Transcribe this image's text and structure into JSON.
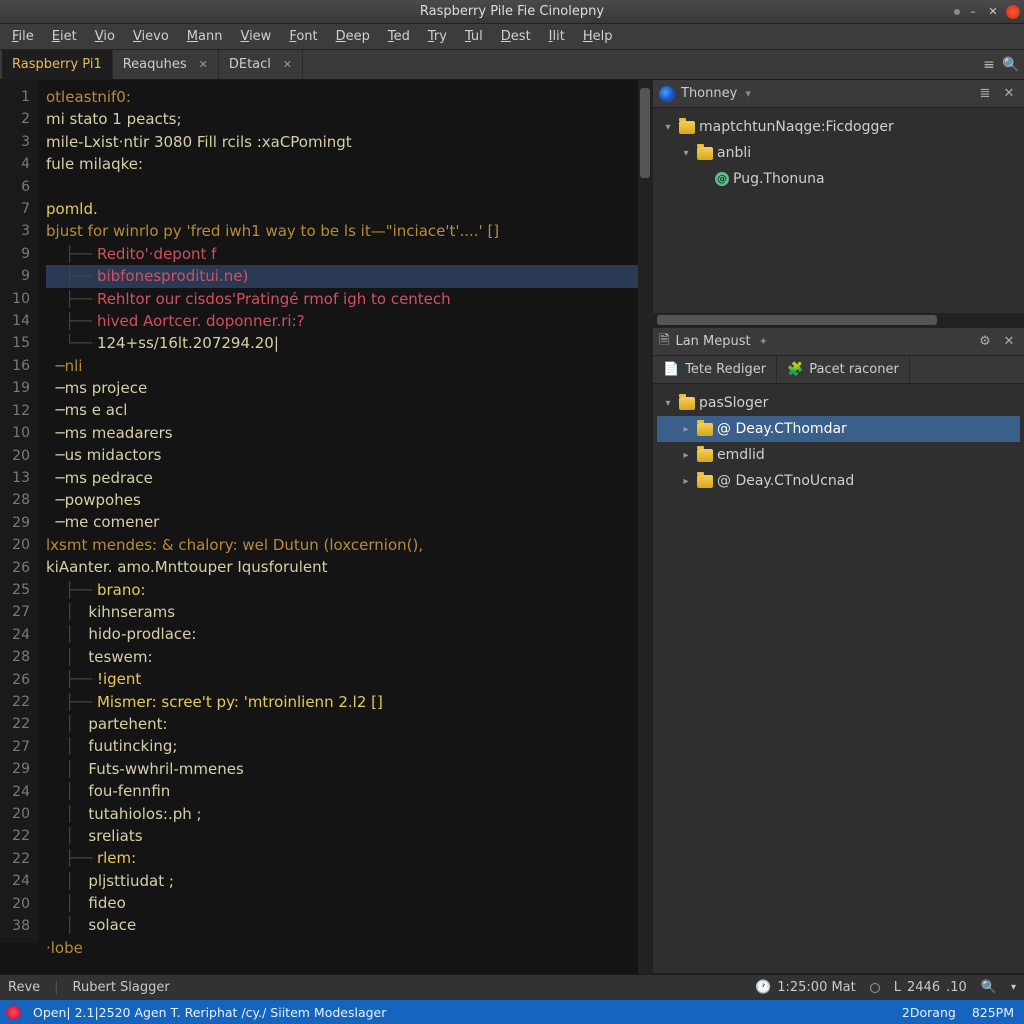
{
  "window": {
    "title": "Raspberry Pile Fie Cinolepny"
  },
  "menu": [
    "File",
    "Eiet",
    "Vio",
    "Vievo",
    "Mann",
    "View",
    "Font",
    "Deep",
    "Ted",
    "Try",
    "Tul",
    "Dest",
    "Ilit",
    "Help"
  ],
  "tabs": [
    {
      "label": "Raspberry Pi1",
      "active": true,
      "closable": false
    },
    {
      "label": "Reaquhes",
      "active": false,
      "closable": true
    },
    {
      "label": "DEtacl",
      "active": false,
      "closable": true
    }
  ],
  "gutter": [
    "1",
    "2",
    "3",
    "4",
    "6",
    "7",
    "3",
    "9",
    "9",
    "10",
    "14",
    "15",
    "16",
    "19",
    "12",
    "10",
    "20",
    "13",
    "28",
    "29",
    "20",
    "26",
    "25",
    "27",
    "24",
    "28",
    "26",
    "22",
    "22",
    "27",
    "29",
    "24",
    "20",
    "22",
    "22",
    "24",
    "20",
    "38"
  ],
  "code": [
    {
      "t": "otleastnif0:",
      "cls": "kw"
    },
    {
      "t": "mi stato 1 peacts;",
      "cls": ""
    },
    {
      "t": "mile-Lxist·ntir 3080 Fill rcils :xaCPomingt",
      "cls": ""
    },
    {
      "t": "fule milaqke:",
      "cls": ""
    },
    {
      "t": "",
      "cls": ""
    },
    {
      "t": "pomld.",
      "cls": "fn"
    },
    {
      "t": "bjust for winrlo py 'fred iwh1 way to be ls it—\"inciace't'....' []",
      "cls": "kw"
    },
    {
      "t": "    ├── Redito'·depont f",
      "cls": "err"
    },
    {
      "t": "    ├── bibfonesproditui.ne)",
      "cls": "err",
      "hl": true
    },
    {
      "t": "    ├── Rehltor our cisdos'Pratingé rmof igh to centech",
      "cls": "err"
    },
    {
      "t": "    ├── hived Aortcer. doponner.ri:?",
      "cls": "err"
    },
    {
      "t": "    └── 124+ss/16lt.207294.20|",
      "cls": ""
    },
    {
      "t": "  ─nli",
      "cls": "kw"
    },
    {
      "t": "  ─ms projece",
      "cls": ""
    },
    {
      "t": "  ─ms e acl",
      "cls": ""
    },
    {
      "t": "  ─ms meadarers",
      "cls": ""
    },
    {
      "t": "  ─us midactors",
      "cls": ""
    },
    {
      "t": "  ─ms pedrace",
      "cls": ""
    },
    {
      "t": "  ─powpohes",
      "cls": ""
    },
    {
      "t": "  ─me comener",
      "cls": ""
    },
    {
      "t": "lxsmt mendes: & chalory: wel Dutun (loxcernion(),",
      "cls": "kw"
    },
    {
      "t": "kiAanter. amo.Mnttouper Iqusforulent",
      "cls": ""
    },
    {
      "t": "    ├── brano:",
      "cls": "fn"
    },
    {
      "t": "    │   kihnserams",
      "cls": ""
    },
    {
      "t": "    │   hido-prodlace:",
      "cls": ""
    },
    {
      "t": "    │   teswem:",
      "cls": ""
    },
    {
      "t": "    ├── !igent",
      "cls": "fn"
    },
    {
      "t": "    ├── Mismer: scree't py: 'mtroinlienn 2.l2 []",
      "cls": "fn"
    },
    {
      "t": "    │   partehent:",
      "cls": ""
    },
    {
      "t": "    │   fuutincking;",
      "cls": ""
    },
    {
      "t": "    │   Futs-wwhril-mmenes",
      "cls": ""
    },
    {
      "t": "    │   fou-fennfin",
      "cls": ""
    },
    {
      "t": "    │   tutahiolos:.ph ;",
      "cls": ""
    },
    {
      "t": "    │   sreliats",
      "cls": ""
    },
    {
      "t": "    ├── rlem:",
      "cls": "fn"
    },
    {
      "t": "    │   pljsttiudat ;",
      "cls": ""
    },
    {
      "t": "    │   fideo",
      "cls": ""
    },
    {
      "t": "    │   solace",
      "cls": ""
    },
    {
      "t": "·lobe",
      "cls": "kw"
    }
  ],
  "panel1": {
    "title": "Thonney",
    "tree": [
      {
        "depth": 0,
        "arrow": "▾",
        "icon": "folder",
        "label": "maptchtunNaqge:Ficdogger"
      },
      {
        "depth": 1,
        "arrow": "▾",
        "icon": "folder",
        "label": "anbli"
      },
      {
        "depth": 2,
        "arrow": "",
        "icon": "mod",
        "label": "Pug.Thonuna"
      }
    ]
  },
  "panel2": {
    "title": "Lan Mepust",
    "subtabs": [
      {
        "icon": "📄",
        "label": "Tete Rediger"
      },
      {
        "icon": "🧩",
        "label": "Pacet raconer"
      }
    ],
    "tree": [
      {
        "depth": 0,
        "arrow": "▾",
        "icon": "folder",
        "label": "pasSloger",
        "sel": false
      },
      {
        "depth": 1,
        "arrow": "▸",
        "icon": "folder",
        "label": "@ Deay.CThomdar",
        "sel": true
      },
      {
        "depth": 1,
        "arrow": "▸",
        "icon": "folder",
        "label": "emdlid",
        "sel": false
      },
      {
        "depth": 1,
        "arrow": "▸",
        "icon": "folder",
        "label": "@ Deay.CTnoUcnad",
        "sel": false
      }
    ]
  },
  "status": {
    "left1": "Reve",
    "left2": "Rubert Slagger",
    "time": "1:25:00 Mat",
    "ln_label": "L",
    "ln": "2446",
    "col": ".10"
  },
  "taskbar": {
    "path": "Open| 2.1|2520 Agen T. Reriphat /cy./ Siitem Modeslager",
    "right1": "2Dorang",
    "right2": "825PM"
  }
}
